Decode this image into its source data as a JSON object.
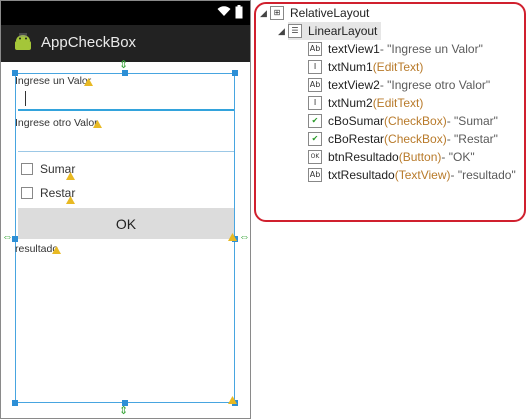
{
  "app": {
    "title": "AppCheckBox"
  },
  "form": {
    "label1": "Ingrese un Valor",
    "label2": "Ingrese otro Valor",
    "checkbox1": "Sumar",
    "checkbox2": "Restar",
    "button": "OK",
    "result": "resultado"
  },
  "outline": {
    "root": "RelativeLayout",
    "child": "LinearLayout",
    "items": [
      {
        "id": "textView1",
        "type": "",
        "value": " - \"Ingrese un Valor\"",
        "icon": "textview-icon"
      },
      {
        "id": "txtNum1",
        "type": " (EditText)",
        "value": "",
        "icon": "edittext-icon"
      },
      {
        "id": "textView2",
        "type": "",
        "value": " - \"Ingrese otro Valor\"",
        "icon": "textview-icon"
      },
      {
        "id": "txtNum2",
        "type": " (EditText)",
        "value": "",
        "icon": "edittext-icon"
      },
      {
        "id": "cBoSumar",
        "type": " (CheckBox)",
        "value": " - \"Sumar\"",
        "icon": "checkbox-icon"
      },
      {
        "id": "cBoRestar",
        "type": " (CheckBox)",
        "value": " - \"Restar\"",
        "icon": "checkbox-icon"
      },
      {
        "id": "btnResultado",
        "type": " (Button)",
        "value": " - \"OK\"",
        "icon": "button-icon"
      },
      {
        "id": "txtResultado",
        "type": " (TextView)",
        "value": " - \"resultado\"",
        "icon": "textview-icon"
      }
    ]
  },
  "colors": {
    "highlight": "#d0202e",
    "selection": "#48a5e0",
    "type_text": "#b87a2a"
  }
}
